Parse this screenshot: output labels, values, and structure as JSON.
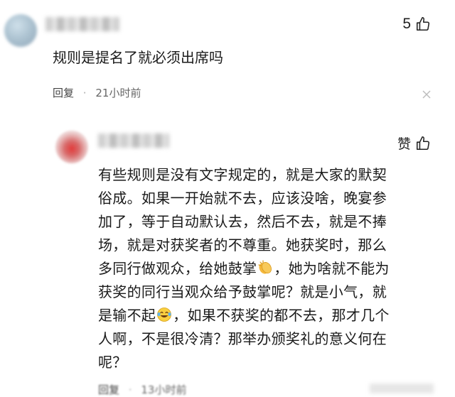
{
  "comment": {
    "text": "规则是提名了就必须出席吗",
    "likes": "5",
    "reply_label": "回复",
    "time": "21小时前"
  },
  "reply": {
    "like_label": "赞",
    "lines": [
      "有些规则是没有文字规定的，就是大家的默契",
      "俗成。如果一开始就不去，应该没啥，晚宴参",
      "加了，等于自动默认去，然后不去，就是不捧",
      "场，就是对获奖者的不尊重。她获奖时，那么",
      "多同行做观众，给她鼓掌",
      "，她为啥就不能为",
      "获奖的同行当观众给予鼓掌呢？就是小气，就",
      "是输不起",
      "，如果不获奖的都不去，那才几个",
      "人啊，不是很冷清？那举办颁奖礼的意义何在",
      "呢？"
    ],
    "reply_label": "回复",
    "time": "13小时前"
  },
  "icons": {
    "like": "thumbs-up-icon",
    "close": "close-icon",
    "clap": "clapping-hands-emoji",
    "laugh": "tears-of-joy-emoji"
  }
}
